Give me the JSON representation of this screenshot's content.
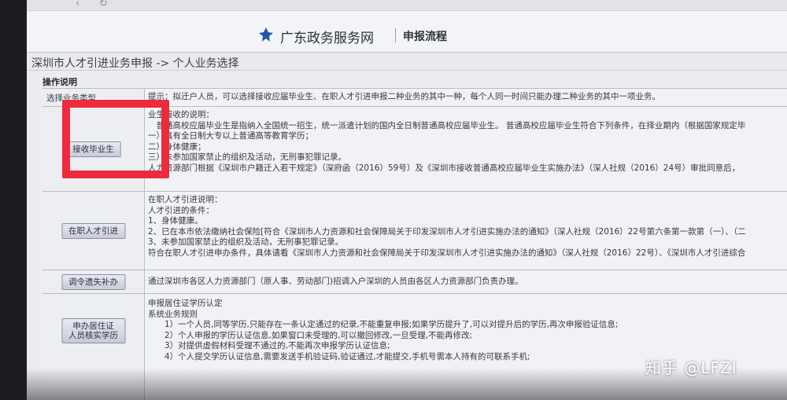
{
  "header": {
    "logo_text": "广东政务服务网",
    "flow_title": "申报流程"
  },
  "breadcrumb": "深圳市人才引进业务申报 -> 个人业务选择",
  "section_title": "操作说明",
  "column_header": "选择业务类型",
  "tip": "提示：拟迁户人员，可以选择接收应届毕业生、在职人才引进申报二种业务的其中一种，每个人同一时间只能办理二种业务的其中一项业务。",
  "rows": [
    {
      "button": "接收毕业生",
      "lines": [
        "业生接收的说明：",
        "　普通高校应届毕业生是指纳入全国统一招生，统一派遣计划的国内全日制普通高校应届毕业生。 普通高校应届毕业生符合下列条件，在择业期内（根据国家规定毕",
        "一）具有全日制大专以上普通高等教育学历；",
        "二）身体健康；",
        "三）未参加国家禁止的组织及活动，无刑事犯罪记录。",
        "人力资源部门根据《深圳市户籍迁入若干规定》（深府函（2016）59号）及《深圳市接收普通高校应届毕业生实施办法》（深人社规（2016）24号）审批同意后，"
      ]
    },
    {
      "button": "在职人才引进",
      "lines": [
        "在职人才引进说明：",
        "人才引进的条件：",
        "1、身体健康。",
        "2、已在本市依法缴纳社会保险[符合《深圳市人力资源和社会保障局关于印发深圳市人才引进实施办法的通知》（深人社规（2016）22号第六条第一款第（一）、（二",
        "3、未参加国家禁止的组织及活动，无刑事犯罪记录。",
        "符合在职人才引进申办条件，具体请看《深圳市人力资源和社会保障局关于印发深圳市人才引进实施办法的通知》（深人社规（2016）22号）、《深圳市人才引进综合"
      ]
    },
    {
      "button": "调令遗失补办",
      "lines": [
        "通过深圳市各区人力资源部门（原人事、劳动部门)招调入户深圳的人员由各区人力资源部门负责办理。"
      ]
    },
    {
      "button": "申办居住证人员核实学历",
      "button_line1": "申办居住证",
      "button_line2": "人员核实学历",
      "lines": [
        "申报居住证学历认定",
        "系统业务规则",
        "　　1）一个人员,同等学历,只能存在一条认定通过的纪录,不能重复申报;如果学历提升了,可以对提升后的学历,再次申报验证信息;",
        "　　2）个人申报的学历认证信息,如果窗口未受理的,可以撤回修改,一旦受理,不能再修改;",
        "　　3）对提供虚假材料受理不通过的,不能再次申报学历认证信息;",
        "　　4）个人提交学历认证信息,需要发送手机验证码,验证通过,才能提交,手机号需本人持有的可联系手机;"
      ]
    }
  ],
  "watermark": "知乎 @LFZI",
  "colors": {
    "highlight": "#ee2b3c",
    "page_bg": "#ecedf1",
    "border": "#b9bcc5"
  }
}
